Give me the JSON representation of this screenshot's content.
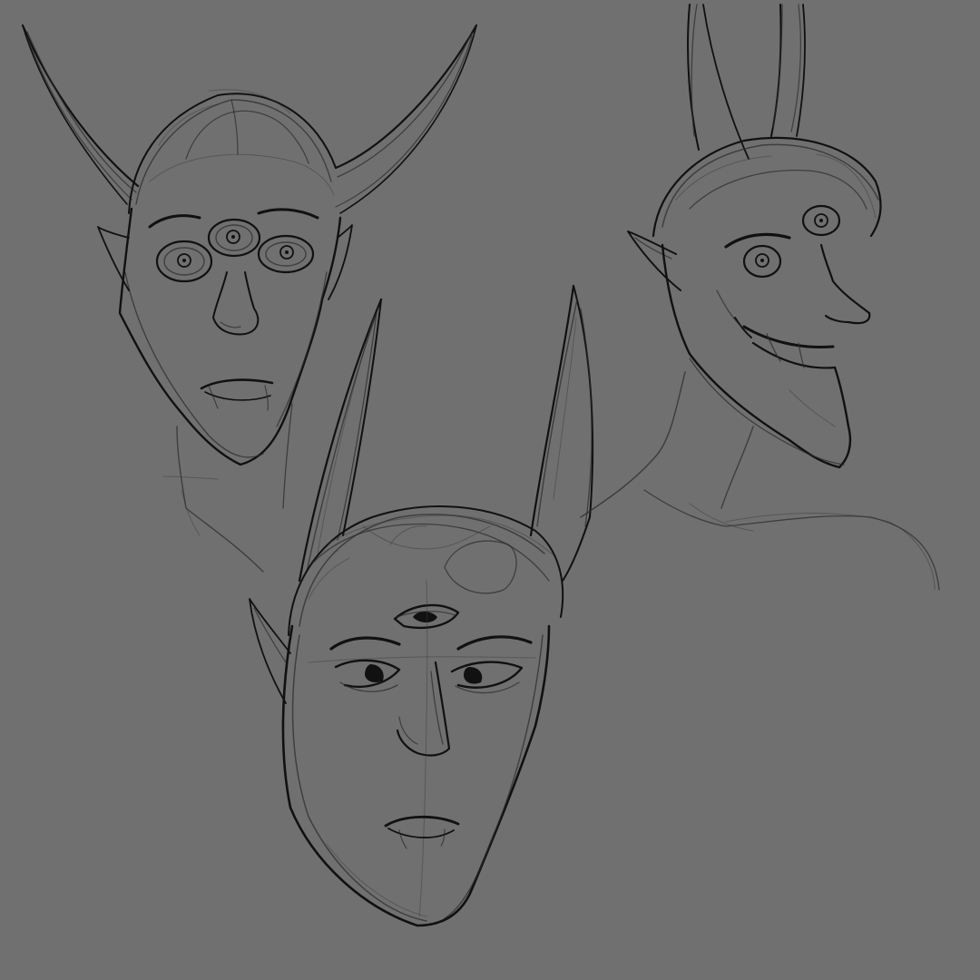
{
  "canvas": {
    "background_color": "#707070",
    "ink_color": "#111111"
  },
  "sketches": [
    {
      "name": "horned-head-three-eyed",
      "icon": "three-eyed-horned-demon-face"
    },
    {
      "name": "long-eared-head-front",
      "icon": "long-eared-third-eye-face"
    },
    {
      "name": "grinning-head-profile",
      "icon": "grinning-profile-face-with-third-eye"
    }
  ]
}
